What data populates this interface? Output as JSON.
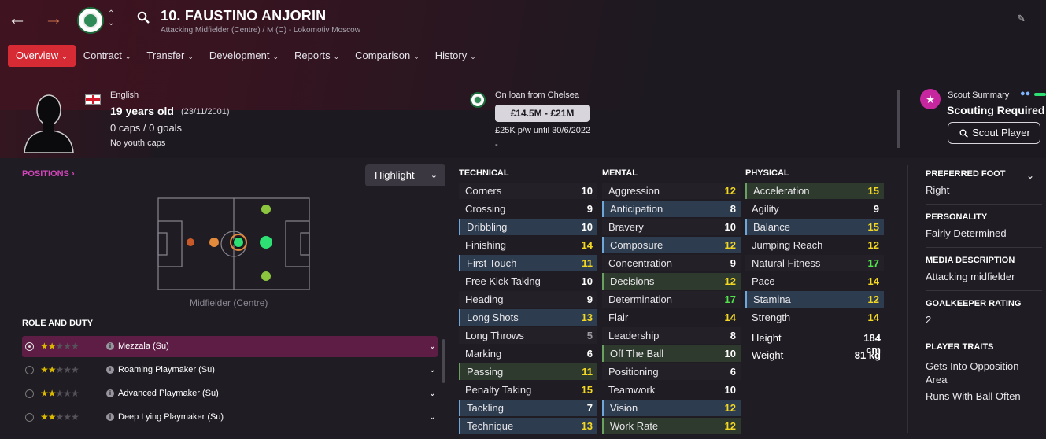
{
  "header": {
    "player_name": "10. FAUSTINO ANJORIN",
    "player_subtitle": "Attacking Midfielder (Centre) / M (C) - Lokomotiv Moscow"
  },
  "nav": {
    "tabs": [
      {
        "label": "Overview",
        "active": true
      },
      {
        "label": "Contract"
      },
      {
        "label": "Transfer"
      },
      {
        "label": "Development"
      },
      {
        "label": "Reports"
      },
      {
        "label": "Comparison"
      },
      {
        "label": "History"
      }
    ]
  },
  "profile": {
    "nationality": "English",
    "age": "19 years old",
    "dob": "(23/11/2001)",
    "caps": "0 caps / 0 goals",
    "youth_caps": "No youth caps"
  },
  "loan": {
    "from": "On loan from Chelsea",
    "value": "£14.5M - £21M",
    "wage": "£25K p/w until 30/6/2022",
    "extra": "-"
  },
  "scout": {
    "title": "Scout Summary",
    "status": "Scouting Required",
    "button": "Scout Player"
  },
  "positions": {
    "link": "POSITIONS ›",
    "highlight_label": "Highlight",
    "position_label": "Midfielder (Centre)",
    "colors": {
      "natural": "#2ee073",
      "accomplished": "#8cc63f",
      "unconvincing": "#e28b3c",
      "awkward": "#c85a2a"
    }
  },
  "roles": {
    "heading": "ROLE AND DUTY",
    "items": [
      {
        "name": "Mezzala (Su)",
        "stars": 2,
        "selected": true
      },
      {
        "name": "Roaming Playmaker (Su)",
        "stars": 2
      },
      {
        "name": "Advanced Playmaker (Su)",
        "stars": 2
      },
      {
        "name": "Deep Lying Playmaker (Su)",
        "stars": 2
      }
    ]
  },
  "technical": {
    "heading": "TECHNICAL",
    "items": [
      {
        "name": "Corners",
        "value": "10"
      },
      {
        "name": "Crossing",
        "value": "9"
      },
      {
        "name": "Dribbling",
        "value": "10"
      },
      {
        "name": "Finishing",
        "value": "14"
      },
      {
        "name": "First Touch",
        "value": "11"
      },
      {
        "name": "Free Kick Taking",
        "value": "10"
      },
      {
        "name": "Heading",
        "value": "9"
      },
      {
        "name": "Long Shots",
        "value": "13"
      },
      {
        "name": "Long Throws",
        "value": "5"
      },
      {
        "name": "Marking",
        "value": "6"
      },
      {
        "name": "Passing",
        "value": "11"
      },
      {
        "name": "Penalty Taking",
        "value": "15"
      },
      {
        "name": "Tackling",
        "value": "7"
      },
      {
        "name": "Technique",
        "value": "13"
      }
    ]
  },
  "mental": {
    "heading": "MENTAL",
    "items": [
      {
        "name": "Aggression",
        "value": "12"
      },
      {
        "name": "Anticipation",
        "value": "8"
      },
      {
        "name": "Bravery",
        "value": "10"
      },
      {
        "name": "Composure",
        "value": "12"
      },
      {
        "name": "Concentration",
        "value": "9"
      },
      {
        "name": "Decisions",
        "value": "12"
      },
      {
        "name": "Determination",
        "value": "17"
      },
      {
        "name": "Flair",
        "value": "14"
      },
      {
        "name": "Leadership",
        "value": "8"
      },
      {
        "name": "Off The Ball",
        "value": "10"
      },
      {
        "name": "Positioning",
        "value": "6"
      },
      {
        "name": "Teamwork",
        "value": "10"
      },
      {
        "name": "Vision",
        "value": "12"
      },
      {
        "name": "Work Rate",
        "value": "12"
      }
    ]
  },
  "physical": {
    "heading": "PHYSICAL",
    "items": [
      {
        "name": "Acceleration",
        "value": "15"
      },
      {
        "name": "Agility",
        "value": "9"
      },
      {
        "name": "Balance",
        "value": "15"
      },
      {
        "name": "Jumping Reach",
        "value": "12"
      },
      {
        "name": "Natural Fitness",
        "value": "17"
      },
      {
        "name": "Pace",
        "value": "14"
      },
      {
        "name": "Stamina",
        "value": "12"
      },
      {
        "name": "Strength",
        "value": "14"
      }
    ],
    "height_label": "Height",
    "height": "184 cm",
    "weight_label": "Weight",
    "weight": "81 kg"
  },
  "info": {
    "preferred_foot_label": "PREFERRED FOOT",
    "preferred_foot": "Right",
    "personality_label": "PERSONALITY",
    "personality": "Fairly Determined",
    "media_label": "MEDIA DESCRIPTION",
    "media": "Attacking midfielder",
    "gk_label": "GOALKEEPER RATING",
    "gk": "2",
    "traits_label": "PLAYER TRAITS",
    "traits": [
      "Gets Into Opposition Area",
      "Runs With Ball Often"
    ]
  }
}
